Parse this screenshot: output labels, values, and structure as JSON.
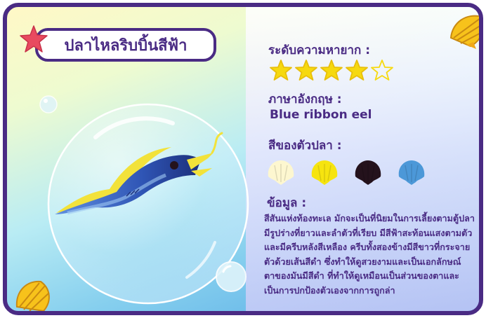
{
  "card": {
    "title": "ปลาไหลริบบิ้นสีฟ้า",
    "rarity_label": "ระดับความหายาก :",
    "rarity_stars": 4,
    "rarity_max": 5,
    "english_label": "ภาษาอังกฤษ :",
    "english_name": "Blue ribbon eel",
    "colors_label": "สีของตัวปลา :",
    "colors": [
      "#fdf7d0",
      "#f6e40f",
      "#24121c",
      "#4c98d8"
    ],
    "info_label": "ข้อมูล :",
    "info_text": "สีสันแห่งท้องทะเล มักจะเป็นที่นิยมในการเลี้ยงตามตู้ปลา มีรูปร่างที่ยาวและลำตัวที่เรียบ มีสีฟ้าสะท้อนแสงตามตัวและมีครีบหลังสีเหลือง ครีบทั้งสองข้างมีสีขาวที่กระจายตัวด้วยเส้นสีดำ ซึ่งทำให้ดูสวยงามและเป็นเอกลักษณ์ ตาของมันมีสีดำ ที่ทำให้ดูเหมือนเป็นส่วนของตาและเป็นการปกป้องตัวเองจากการถูกล่า"
  },
  "theme": {
    "frame": "#4a2b84",
    "star_fill": "#f6d90f",
    "accent_red": "#e84a5f",
    "shell": "#f7c21b"
  }
}
